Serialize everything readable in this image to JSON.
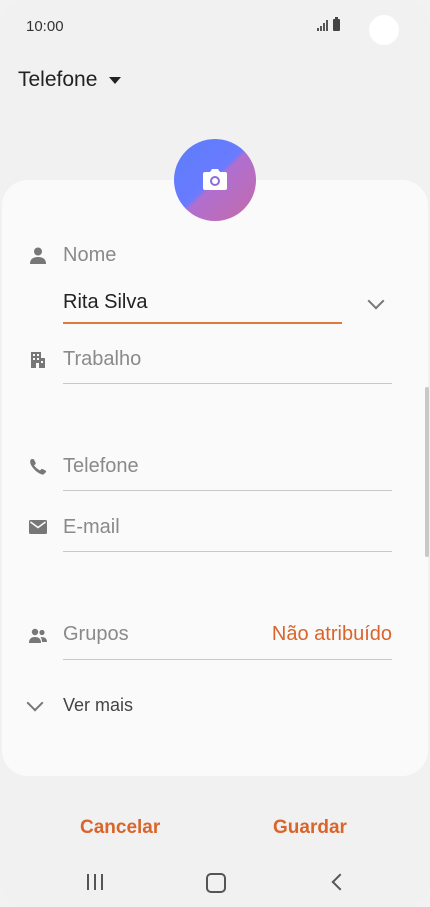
{
  "status_bar": {
    "time": "10:00"
  },
  "header": {
    "storage_label": "Telefone"
  },
  "form": {
    "name_label": "Nome",
    "name_value": "Rita Silva",
    "work_label": "Trabalho",
    "phone_label": "Telefone",
    "email_label": "E-mail",
    "groups_label": "Grupos",
    "groups_value": "Não atribuído",
    "see_more_label": "Ver mais"
  },
  "actions": {
    "cancel_label": "Cancelar",
    "save_label": "Guardar"
  },
  "icons": {
    "name": "person-icon",
    "work": "building-icon",
    "phone": "phone-icon",
    "email": "mail-icon",
    "groups": "group-icon",
    "avatar": "camera-icon"
  },
  "colors": {
    "accent": "#d9652a",
    "active_line": "#e07a3c",
    "background": "#f1f1f1",
    "card": "#fafafa"
  }
}
